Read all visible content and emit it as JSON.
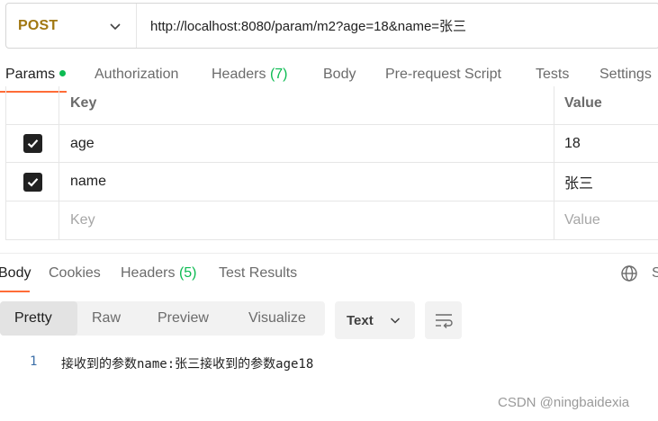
{
  "request": {
    "method": "POST",
    "url": "http://localhost:8080/param/m2?age=18&name=张三"
  },
  "request_tabs": {
    "params": "Params",
    "authorization": "Authorization",
    "headers": "Headers",
    "headers_count": "(7)",
    "body": "Body",
    "prerequest": "Pre-request Script",
    "tests": "Tests",
    "settings": "Settings"
  },
  "params_table": {
    "key_header": "Key",
    "value_header": "Value",
    "rows": [
      {
        "key": "age",
        "value": "18",
        "checked": true
      },
      {
        "key": "name",
        "value": "张三",
        "checked": true
      }
    ],
    "key_placeholder": "Key",
    "value_placeholder": "Value"
  },
  "response_tabs": {
    "body": "Body",
    "cookies": "Cookies",
    "headers": "Headers",
    "headers_count": "(5)",
    "test_results": "Test Results",
    "save_partial": "S"
  },
  "view_modes": {
    "pretty": "Pretty",
    "raw": "Raw",
    "preview": "Preview",
    "visualize": "Visualize"
  },
  "format": {
    "selected": "Text"
  },
  "response_body": {
    "lines": [
      {
        "number": "1",
        "text": "接收到的参数name:张三接收到的参数age18"
      }
    ]
  },
  "watermark": "CSDN @ningbaidexia",
  "colors": {
    "accent": "#ff6c37",
    "method_post": "#a17812",
    "count_green": "#0cbb52"
  }
}
